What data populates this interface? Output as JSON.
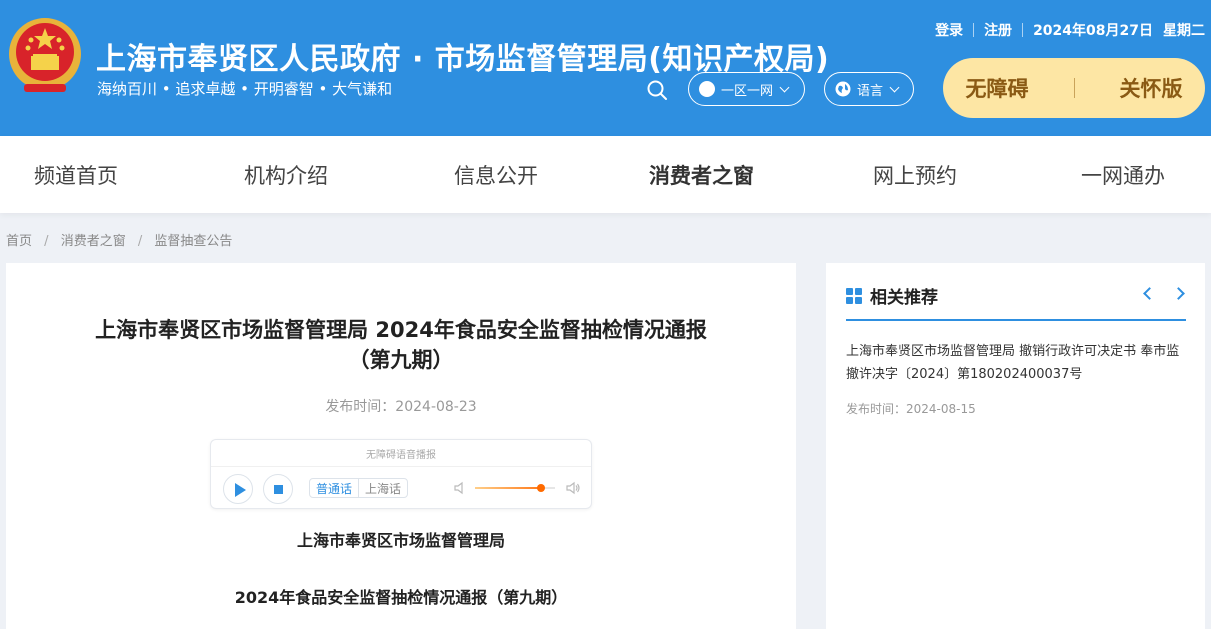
{
  "header": {
    "site_title": "上海市奉贤区人民政府 · 市场监督管理局(知识产权局)",
    "slogan": "海纳百川 • 追求卓越 • 开明睿智 • 大气谦和",
    "login": "登录",
    "register": "注册",
    "date": "2024年08月27日",
    "weekday": "星期二",
    "region_label": "一区一网",
    "language_label": "语言",
    "accessibility_label": "无障碍",
    "care_label": "关怀版",
    "accent_color": "#2e8fe0",
    "care_box_color": "#fde6a4"
  },
  "nav": {
    "items": [
      {
        "label": "频道首页"
      },
      {
        "label": "机构介绍"
      },
      {
        "label": "信息公开"
      },
      {
        "label": "消费者之窗"
      },
      {
        "label": "网上预约"
      },
      {
        "label": "一网通办"
      }
    ],
    "active": "消费者之窗"
  },
  "breadcrumb": [
    "首页",
    "消费者之窗",
    "监督抽查公告"
  ],
  "article": {
    "title": "上海市奉贤区市场监督管理局 2024年食品安全监督抽检情况通报（第九期）",
    "published": "发布时间：2024-08-23",
    "player": {
      "caption": "无障碍语音播报",
      "dialects": [
        "普通话",
        "上海话"
      ],
      "selected_dialect": "普通话",
      "volume_fraction": 0.82
    },
    "org": "上海市奉贤区市场监督管理局",
    "subtitle": "2024年食品安全监督抽检情况通报（第九期）"
  },
  "sidebar": {
    "title": "相关推荐",
    "items": [
      {
        "text": "上海市奉贤区市场监督管理局 撤销行政许可决定书 奉市监撤许决字〔2024〕第180202400037号",
        "date": "发布时间：2024-08-15"
      }
    ]
  },
  "icons": {
    "emblem": "national-emblem-icon",
    "search": "search-icon",
    "region": "region-icon",
    "language": "globe-icon",
    "play": "play-icon",
    "stop": "stop-icon",
    "volume_low": "volume-low-icon",
    "volume_high": "volume-high-icon",
    "recommend": "grid-icon",
    "prev": "chevron-left-icon",
    "next": "chevron-right-icon"
  }
}
